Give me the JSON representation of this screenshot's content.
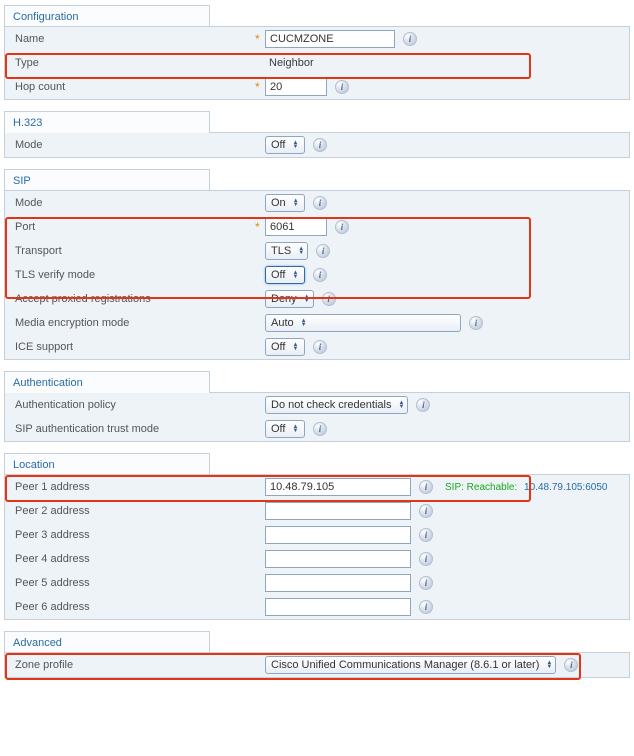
{
  "configuration": {
    "title": "Configuration",
    "name_label": "Name",
    "name_value": "CUCMZONE",
    "type_label": "Type",
    "type_value": "Neighbor",
    "hop_label": "Hop count",
    "hop_value": "20"
  },
  "h323": {
    "title": "H.323",
    "mode_label": "Mode",
    "mode_value": "Off"
  },
  "sip": {
    "title": "SIP",
    "mode_label": "Mode",
    "mode_value": "On",
    "port_label": "Port",
    "port_value": "6061",
    "transport_label": "Transport",
    "transport_value": "TLS",
    "tlsverify_label": "TLS verify mode",
    "tlsverify_value": "Off",
    "accept_proxied_label": "Accept proxied registrations",
    "accept_proxied_value": "Deny",
    "media_enc_label": "Media encryption mode",
    "media_enc_value": "Auto",
    "ice_label": "ICE support",
    "ice_value": "Off"
  },
  "authentication": {
    "title": "Authentication",
    "policy_label": "Authentication policy",
    "policy_value": "Do not check credentials",
    "trust_label": "SIP authentication trust mode",
    "trust_value": "Off"
  },
  "location": {
    "title": "Location",
    "peer1_label": "Peer 1 address",
    "peer1_value": "10.48.79.105",
    "peer1_status_prefix": "SIP: Reachable:",
    "peer1_status_addr": "10.48.79.105:6050",
    "peer2_label": "Peer 2 address",
    "peer2_value": "",
    "peer3_label": "Peer 3 address",
    "peer3_value": "",
    "peer4_label": "Peer 4 address",
    "peer4_value": "",
    "peer5_label": "Peer 5 address",
    "peer5_value": "",
    "peer6_label": "Peer 6 address",
    "peer6_value": ""
  },
  "advanced": {
    "title": "Advanced",
    "zone_profile_label": "Zone profile",
    "zone_profile_value": "Cisco Unified Communications Manager (8.6.1 or later)"
  },
  "icons": {
    "info": "i"
  }
}
